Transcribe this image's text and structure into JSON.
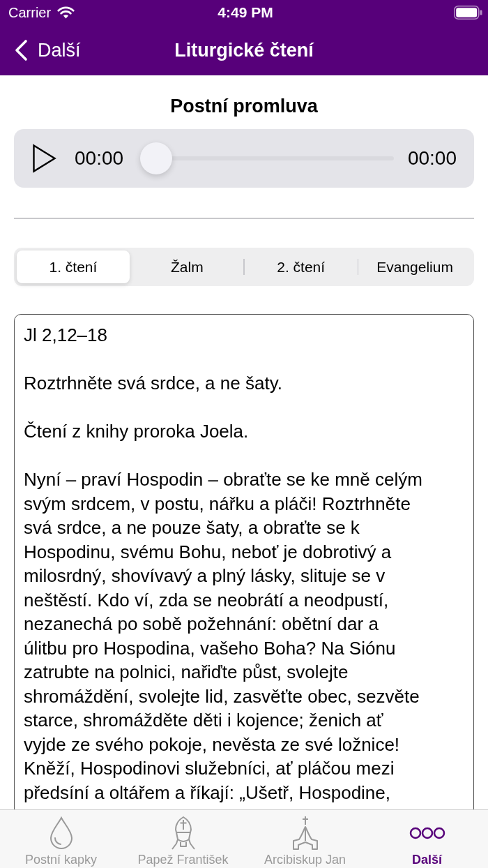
{
  "status_bar": {
    "carrier": "Carrier",
    "time": "4:49 PM"
  },
  "nav_bar": {
    "back_label": "Další",
    "title": "Liturgické čtení"
  },
  "audio": {
    "title": "Postní promluva",
    "elapsed": "00:00",
    "level": 0,
    "duration": "00:00"
  },
  "reading_tabs": [
    {
      "label": "1. čtení",
      "selected": true
    },
    {
      "label": "Žalm",
      "selected": false
    },
    {
      "label": "2. čtení",
      "selected": false
    },
    {
      "label": "Evangelium",
      "selected": false
    }
  ],
  "reading": {
    "reference": "Jl 2,12–18",
    "motto": "Roztrhněte svá srdce, a ne šaty.",
    "source": "Čtení z knihy proroka Joela.",
    "body_lines": [
      "Nyní – praví Hospodin – obraťte se ke mně celým",
      "svým srdcem, v postu, nářku a pláči! Roztrhněte",
      "svá srdce, a ne pouze šaty, a obraťte se k",
      "Hospodinu, svému Bohu, neboť je dobrotivý a",
      "milosrdný, shovívavý a plný lásky, slituje se v",
      "neštěstí. Kdo ví, zda se neobrátí a neodpustí,",
      "nezanechá po sobě požehnání: obětní dar a",
      "úlitbu pro Hospodina, vašeho Boha? Na Siónu",
      "zatrubte na polnici, nařiďte půst, svolejte",
      "shromáždění, svolejte lid, zasvěťte obec, sezvěte",
      "starce, shromážděte děti i kojence; ženich ať",
      "vyjde ze svého pokoje, nevěsta ze své ložnice!",
      "Kněží, Hospodinovi služebníci, ať pláčou mezi",
      "předsíní a oltářem a říkají: „Ušetř, Hospodine,"
    ]
  },
  "tab_bar": [
    {
      "label": "Postní kapky",
      "kind": "drop",
      "selected": false
    },
    {
      "label": "Papež František",
      "kind": "bishop",
      "selected": false
    },
    {
      "label": "Arcibiskup Jan",
      "kind": "praying-hands",
      "selected": false
    },
    {
      "label": "Další",
      "kind": "more",
      "selected": true
    }
  ]
}
